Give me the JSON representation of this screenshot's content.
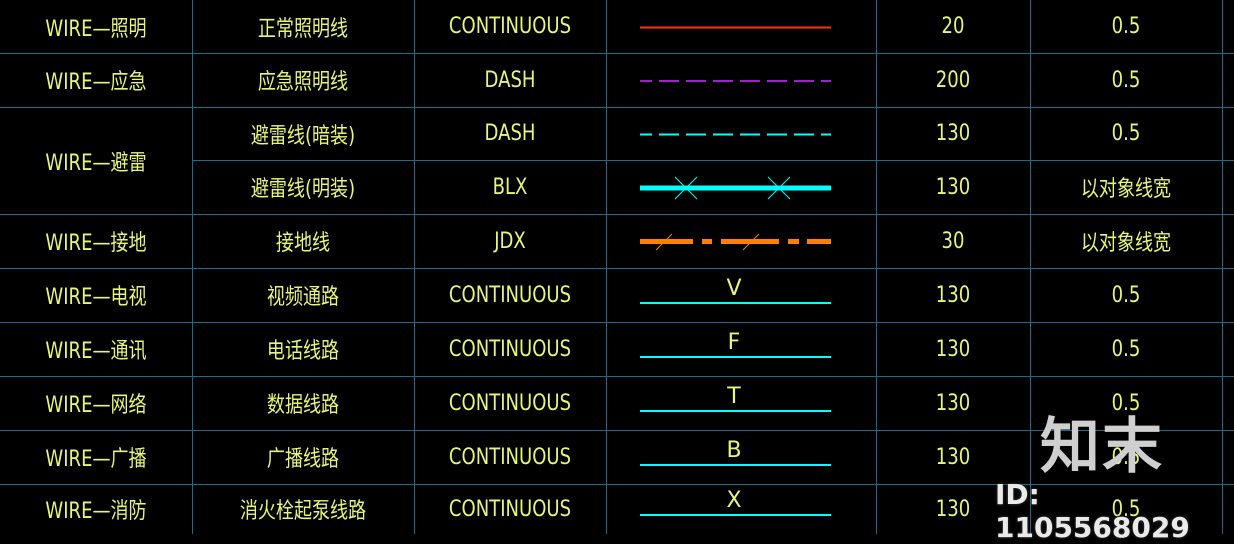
{
  "rows": [
    {
      "layer": "WIRE—照明",
      "desc": "正常照明线",
      "linetype": "CONTINUOUS",
      "sample": {
        "style": "solid",
        "color": "#ff3300"
      },
      "scale": "20",
      "width": "0.5"
    },
    {
      "layer": "WIRE—应急",
      "desc": "应急照明线",
      "linetype": "DASH",
      "sample": {
        "style": "dash",
        "color": "#a020d0"
      },
      "scale": "200",
      "width": "0.5"
    },
    {
      "layer": "WIRE—避雷",
      "desc": "避雷线(暗装)",
      "linetype": "DASH",
      "sample": {
        "style": "dash",
        "color": "#00ffff"
      },
      "scale": "130",
      "width": "0.5"
    },
    {
      "layer": "",
      "desc": "避雷线(明装)",
      "linetype": "BLX",
      "sample": {
        "style": "thick-x",
        "color": "#00ffff"
      },
      "scale": "130",
      "width": "以对象线宽"
    },
    {
      "layer": "WIRE—接地",
      "desc": "接地线",
      "linetype": "JDX",
      "sample": {
        "style": "thick-dashdot",
        "color": "#ff8000"
      },
      "scale": "30",
      "width": "以对象线宽"
    },
    {
      "layer": "WIRE—电视",
      "desc": "视频通路",
      "linetype": "CONTINUOUS",
      "sample": {
        "style": "labeled",
        "label": "V",
        "color": "#00ffff"
      },
      "scale": "130",
      "width": "0.5"
    },
    {
      "layer": "WIRE—通讯",
      "desc": "电话线路",
      "linetype": "CONTINUOUS",
      "sample": {
        "style": "labeled",
        "label": "F",
        "color": "#00ffff"
      },
      "scale": "130",
      "width": "0.5"
    },
    {
      "layer": "WIRE—网络",
      "desc": "数据线路",
      "linetype": "CONTINUOUS",
      "sample": {
        "style": "labeled",
        "label": "T",
        "color": "#00ffff"
      },
      "scale": "130",
      "width": "0.5"
    },
    {
      "layer": "WIRE—广播",
      "desc": "广播线路",
      "linetype": "CONTINUOUS",
      "sample": {
        "style": "labeled",
        "label": "B",
        "color": "#00ffff"
      },
      "scale": "130",
      "width": "0.5"
    },
    {
      "layer": "WIRE—消防",
      "desc": "消火栓起泵线路",
      "linetype": "CONTINUOUS",
      "sample": {
        "style": "labeled",
        "label": "X",
        "color": "#00ffff"
      },
      "scale": "130",
      "width": "0.5"
    }
  ],
  "watermark": {
    "logo": "知末",
    "id": "ID: 1105568029"
  },
  "colors": {
    "text": "#e8f57a",
    "grid": "#1b6c8c",
    "background": "#000000"
  }
}
